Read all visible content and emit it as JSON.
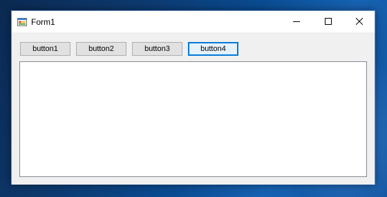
{
  "window": {
    "title": "Form1",
    "icons": {
      "app": "winforms-app-icon",
      "minimize": "minimize-icon",
      "maximize": "maximize-icon",
      "close": "close-icon"
    }
  },
  "buttons": [
    {
      "label": "button1",
      "focused": false
    },
    {
      "label": "button2",
      "focused": false
    },
    {
      "label": "button3",
      "focused": false
    },
    {
      "label": "button4",
      "focused": true
    }
  ],
  "colors": {
    "accent": "#0078d7",
    "window_bg": "#f0f0f0",
    "titlebar_bg": "#ffffff"
  }
}
